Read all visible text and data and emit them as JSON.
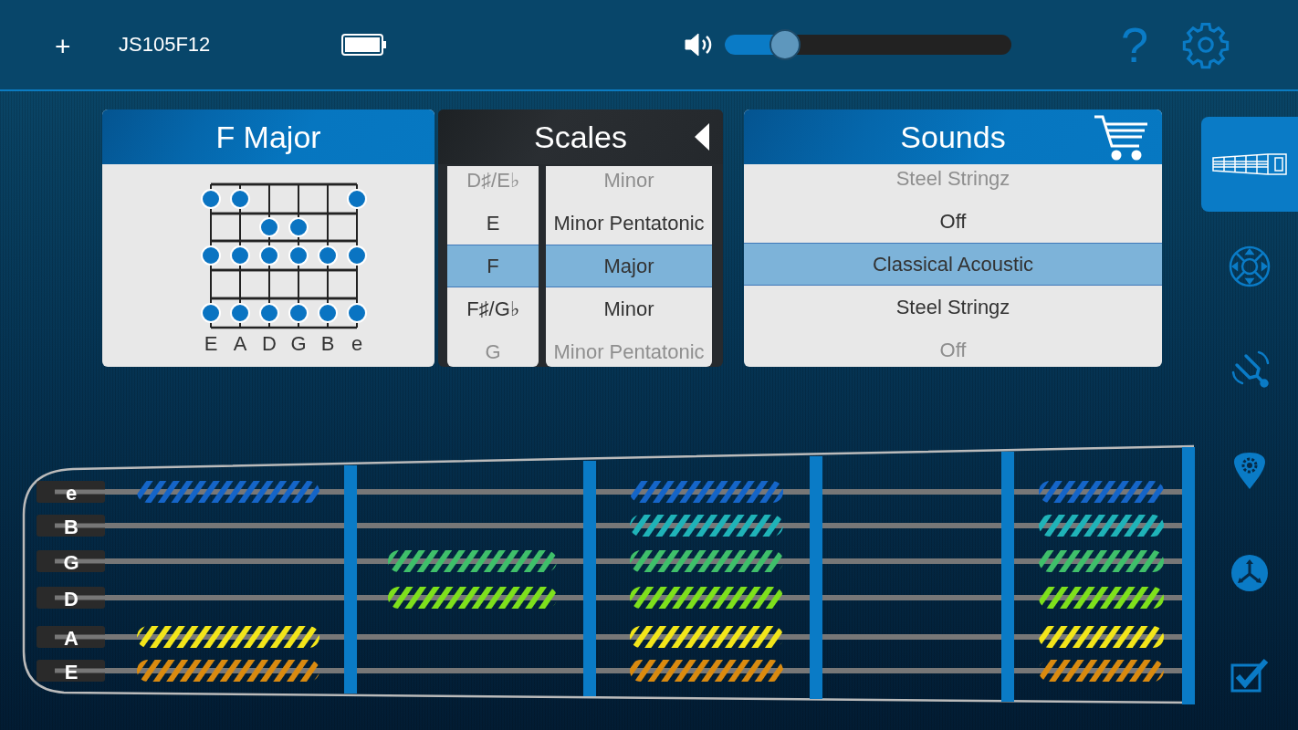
{
  "top_bar": {
    "add": "+",
    "device": "JS105F12",
    "help": "?",
    "volume": {
      "level": 0.21
    }
  },
  "chord_card": {
    "title": "F Major",
    "strings": [
      "E",
      "A",
      "D",
      "G",
      "B",
      "e"
    ],
    "frets": [
      {
        "dots": [
          true,
          true,
          false,
          false,
          false,
          true
        ]
      },
      {
        "dots": [
          false,
          false,
          true,
          true,
          false,
          false
        ]
      },
      {
        "dots": [
          true,
          true,
          true,
          true,
          true,
          true
        ]
      },
      {
        "dots": [
          false,
          false,
          false,
          false,
          false,
          false
        ]
      },
      {
        "dots": [
          true,
          true,
          true,
          true,
          true,
          true
        ]
      }
    ]
  },
  "scales": {
    "title": "Scales",
    "roots": [
      {
        "label": "D♯/E♭",
        "selected": false,
        "dimmed": true
      },
      {
        "label": "E",
        "selected": false,
        "dimmed": false
      },
      {
        "label": "F",
        "selected": true,
        "dimmed": false
      },
      {
        "label": "F♯/G♭",
        "selected": false,
        "dimmed": false
      },
      {
        "label": "G",
        "selected": false,
        "dimmed": true
      }
    ],
    "types": [
      {
        "label": "Minor",
        "selected": false,
        "dimmed": true
      },
      {
        "label": "Minor Pentatonic",
        "selected": false,
        "dimmed": false
      },
      {
        "label": "Major",
        "selected": true,
        "dimmed": false
      },
      {
        "label": "Minor",
        "selected": false,
        "dimmed": false
      },
      {
        "label": "Minor Pentatonic",
        "selected": false,
        "dimmed": true
      }
    ]
  },
  "sounds": {
    "title": "Sounds",
    "items": [
      {
        "label": "Steel Stringz",
        "selected": false,
        "dimmed": true
      },
      {
        "label": "Off",
        "selected": false,
        "dimmed": false
      },
      {
        "label": "Classical Acoustic",
        "selected": true,
        "dimmed": false
      },
      {
        "label": "Steel Stringz",
        "selected": false,
        "dimmed": false
      },
      {
        "label": "Off",
        "selected": false,
        "dimmed": true
      }
    ]
  },
  "sidebar": {
    "items": [
      {
        "selected": true
      },
      {
        "selected": false
      },
      {
        "selected": false
      },
      {
        "selected": false
      },
      {
        "selected": false
      },
      {
        "selected": false
      }
    ]
  },
  "fretboard": {
    "strings": [
      {
        "label": "e",
        "color": "#1565c8",
        "notes": [
          {
            "lit": true
          },
          {
            "lit": false
          },
          {
            "lit": true
          },
          {
            "lit": false
          },
          {
            "lit": true
          }
        ]
      },
      {
        "label": "B",
        "color": "#1fb3b8",
        "notes": [
          {
            "lit": false
          },
          {
            "lit": false
          },
          {
            "lit": true
          },
          {
            "lit": false
          },
          {
            "lit": true
          }
        ]
      },
      {
        "label": "G",
        "color": "#3fbf6a",
        "notes": [
          {
            "lit": false
          },
          {
            "lit": true
          },
          {
            "lit": true
          },
          {
            "lit": false
          },
          {
            "lit": true
          }
        ]
      },
      {
        "label": "D",
        "color": "#7ee01c",
        "notes": [
          {
            "lit": false
          },
          {
            "lit": true
          },
          {
            "lit": true
          },
          {
            "lit": false
          },
          {
            "lit": true
          }
        ]
      },
      {
        "label": "A",
        "color": "#f2e51a",
        "notes": [
          {
            "lit": true
          },
          {
            "lit": false
          },
          {
            "lit": true
          },
          {
            "lit": false
          },
          {
            "lit": true
          }
        ]
      },
      {
        "label": "E",
        "color": "#d98a10",
        "notes": [
          {
            "lit": true
          },
          {
            "lit": false
          },
          {
            "lit": true
          },
          {
            "lit": false
          },
          {
            "lit": true
          }
        ]
      }
    ]
  }
}
